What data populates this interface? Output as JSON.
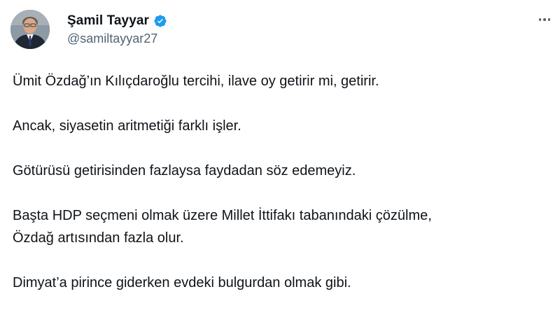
{
  "author": {
    "display_name": "Şamil Tayyar",
    "handle": "@samiltayyar27",
    "verified": true,
    "avatar_icon": "profile-photo",
    "verified_icon": "verified-badge-icon"
  },
  "menu": {
    "icon": "more-options-icon"
  },
  "tweet": {
    "paragraphs": [
      [
        "Ümit Özdağ’ın Kılıçdaroğlu tercihi, ilave oy getirir mi, getirir."
      ],
      [
        "Ancak, siyasetin aritmetiği farklı işler."
      ],
      [
        "Götürüsü getirisinden fazlaysa faydadan söz edemeyiz."
      ],
      [
        "Başta HDP seçmeni olmak üzere Millet İttifakı tabanındaki çözülme,",
        "Özdağ artısından fazla olur."
      ],
      [
        "Dimyat’a pirince giderken evdeki bulgurdan olmak gibi."
      ]
    ]
  },
  "colors": {
    "text": "#0f1419",
    "secondary": "#536471",
    "verified": "#1d9bf0",
    "background": "#ffffff"
  }
}
